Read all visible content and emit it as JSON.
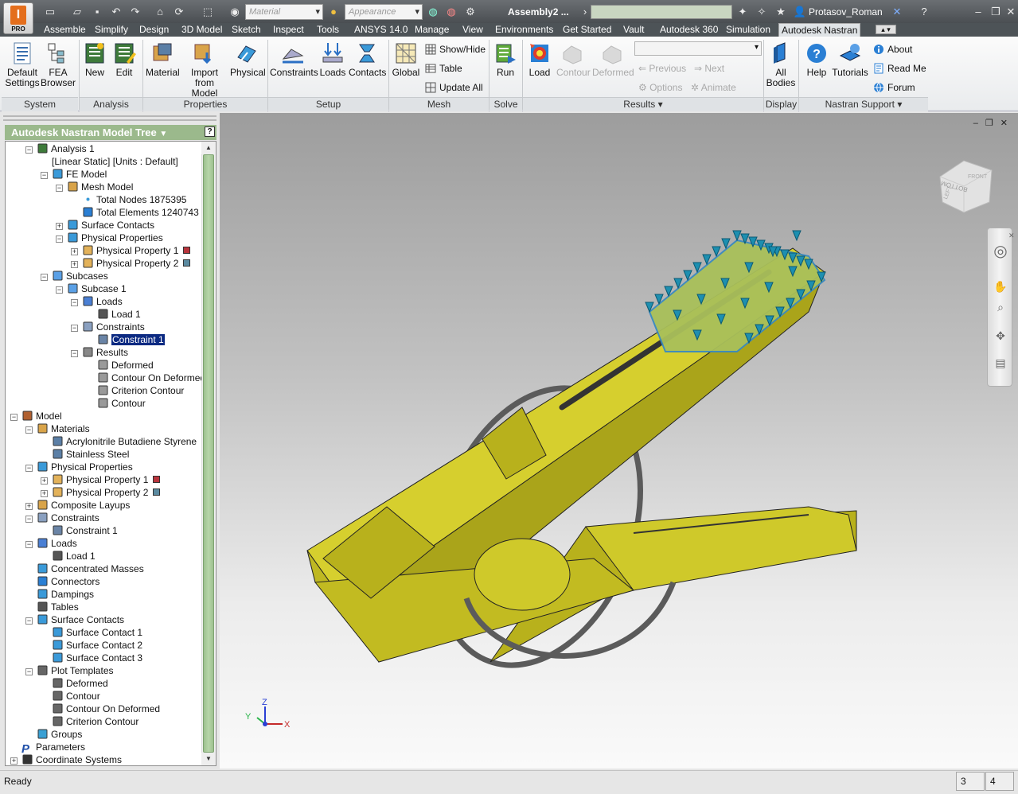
{
  "title_bar": {
    "app_badge": "PRO",
    "material_placeholder": "Material",
    "appearance_placeholder": "Appearance",
    "document_title": "Assembly2 ...",
    "username": "Protasov_Roman"
  },
  "tabs": [
    "Assemble",
    "Simplify",
    "Design",
    "3D Model",
    "Sketch",
    "Inspect",
    "Tools",
    "ANSYS 14.0",
    "Manage",
    "View",
    "Environments",
    "Get Started",
    "Vault",
    "Autodesk 360",
    "Simulation",
    "Autodesk Nastran"
  ],
  "active_tab": "Autodesk Nastran",
  "ribbon": {
    "system": {
      "label": "System",
      "default_settings": "Default\nSettings",
      "fea_browser": "FEA\nBrowser"
    },
    "analysis": {
      "label": "Analysis",
      "new": "New",
      "edit": "Edit"
    },
    "properties": {
      "label": "Properties",
      "material": "Material",
      "import_from_model": "Import from\nModel",
      "physical": "Physical"
    },
    "setup": {
      "label": "Setup",
      "constraints": "Constraints",
      "loads": "Loads",
      "contacts": "Contacts"
    },
    "mesh": {
      "label": "Mesh",
      "global": "Global",
      "show_hide": "Show/Hide",
      "table": "Table",
      "update_all": "Update  All"
    },
    "solve": {
      "label": "Solve",
      "run": "Run"
    },
    "results": {
      "label": "Results",
      "load": "Load",
      "contour": "Contour",
      "deformed": "Deformed",
      "previous": "Previous",
      "next": "Next",
      "options": "Options",
      "animate": "Animate"
    },
    "display": {
      "label": "Display",
      "all_bodies": "All\nBodies"
    },
    "support": {
      "label": "Nastran Support",
      "help": "Help",
      "tutorials": "Tutorials",
      "about": "About",
      "read_me": "Read Me",
      "forum": "Forum"
    }
  },
  "tree": {
    "header": "Autodesk Nastran Model Tree",
    "nodes": [
      {
        "label": "Analysis 1"
      },
      {
        "label": "[Linear Static] [Units : Default]"
      },
      {
        "label": "FE Model"
      },
      {
        "label": "Mesh Model"
      },
      {
        "label": "Total Nodes 1875395"
      },
      {
        "label": "Total Elements 1240743"
      },
      {
        "label": "Surface Contacts"
      },
      {
        "label": "Physical Properties"
      },
      {
        "label": "Physical Property 1",
        "swatch": "#b8343c"
      },
      {
        "label": "Physical Property 2",
        "swatch": "#5b8aa0"
      },
      {
        "label": "Subcases"
      },
      {
        "label": "Subcase 1"
      },
      {
        "label": "Loads"
      },
      {
        "label": "Load 1"
      },
      {
        "label": "Constraints"
      },
      {
        "label": "Constraint 1"
      },
      {
        "label": "Results"
      },
      {
        "label": "Deformed"
      },
      {
        "label": "Contour On Deformed"
      },
      {
        "label": "Criterion Contour"
      },
      {
        "label": "Contour"
      },
      {
        "label": "Model"
      },
      {
        "label": "Materials"
      },
      {
        "label": "Acrylonitrile Butadiene Styrene"
      },
      {
        "label": "Stainless Steel"
      },
      {
        "label": "Physical Properties"
      },
      {
        "label": "Physical Property 1",
        "swatch": "#b8343c"
      },
      {
        "label": "Physical Property 2",
        "swatch": "#5b8aa0"
      },
      {
        "label": "Composite Layups"
      },
      {
        "label": "Constraints"
      },
      {
        "label": "Constraint 1"
      },
      {
        "label": "Loads"
      },
      {
        "label": "Load 1"
      },
      {
        "label": "Concentrated Masses"
      },
      {
        "label": "Connectors"
      },
      {
        "label": "Dampings"
      },
      {
        "label": "Tables"
      },
      {
        "label": "Surface Contacts"
      },
      {
        "label": "Surface Contact 1"
      },
      {
        "label": "Surface Contact 2"
      },
      {
        "label": "Surface Contact 3"
      },
      {
        "label": "Plot Templates"
      },
      {
        "label": "Deformed"
      },
      {
        "label": "Contour"
      },
      {
        "label": "Contour On Deformed"
      },
      {
        "label": "Criterion Contour"
      },
      {
        "label": "Groups"
      },
      {
        "label": "Parameters"
      },
      {
        "label": "Coordinate Systems"
      }
    ]
  },
  "viewcube": {
    "front": "FRONT",
    "left": "LEFT",
    "bottom": "BOTTOM"
  },
  "triad": {
    "x": "X",
    "y": "Y",
    "z": "Z"
  },
  "status": {
    "text": "Ready",
    "cell1": "3",
    "cell2": "4"
  },
  "colors": {
    "model_body": "#cfc92a",
    "mesh_face": "#a9c05a",
    "constraint_glyph": "#1d8fb0",
    "ring": "#5b5b5b",
    "tree_header": "#9bb98c"
  }
}
